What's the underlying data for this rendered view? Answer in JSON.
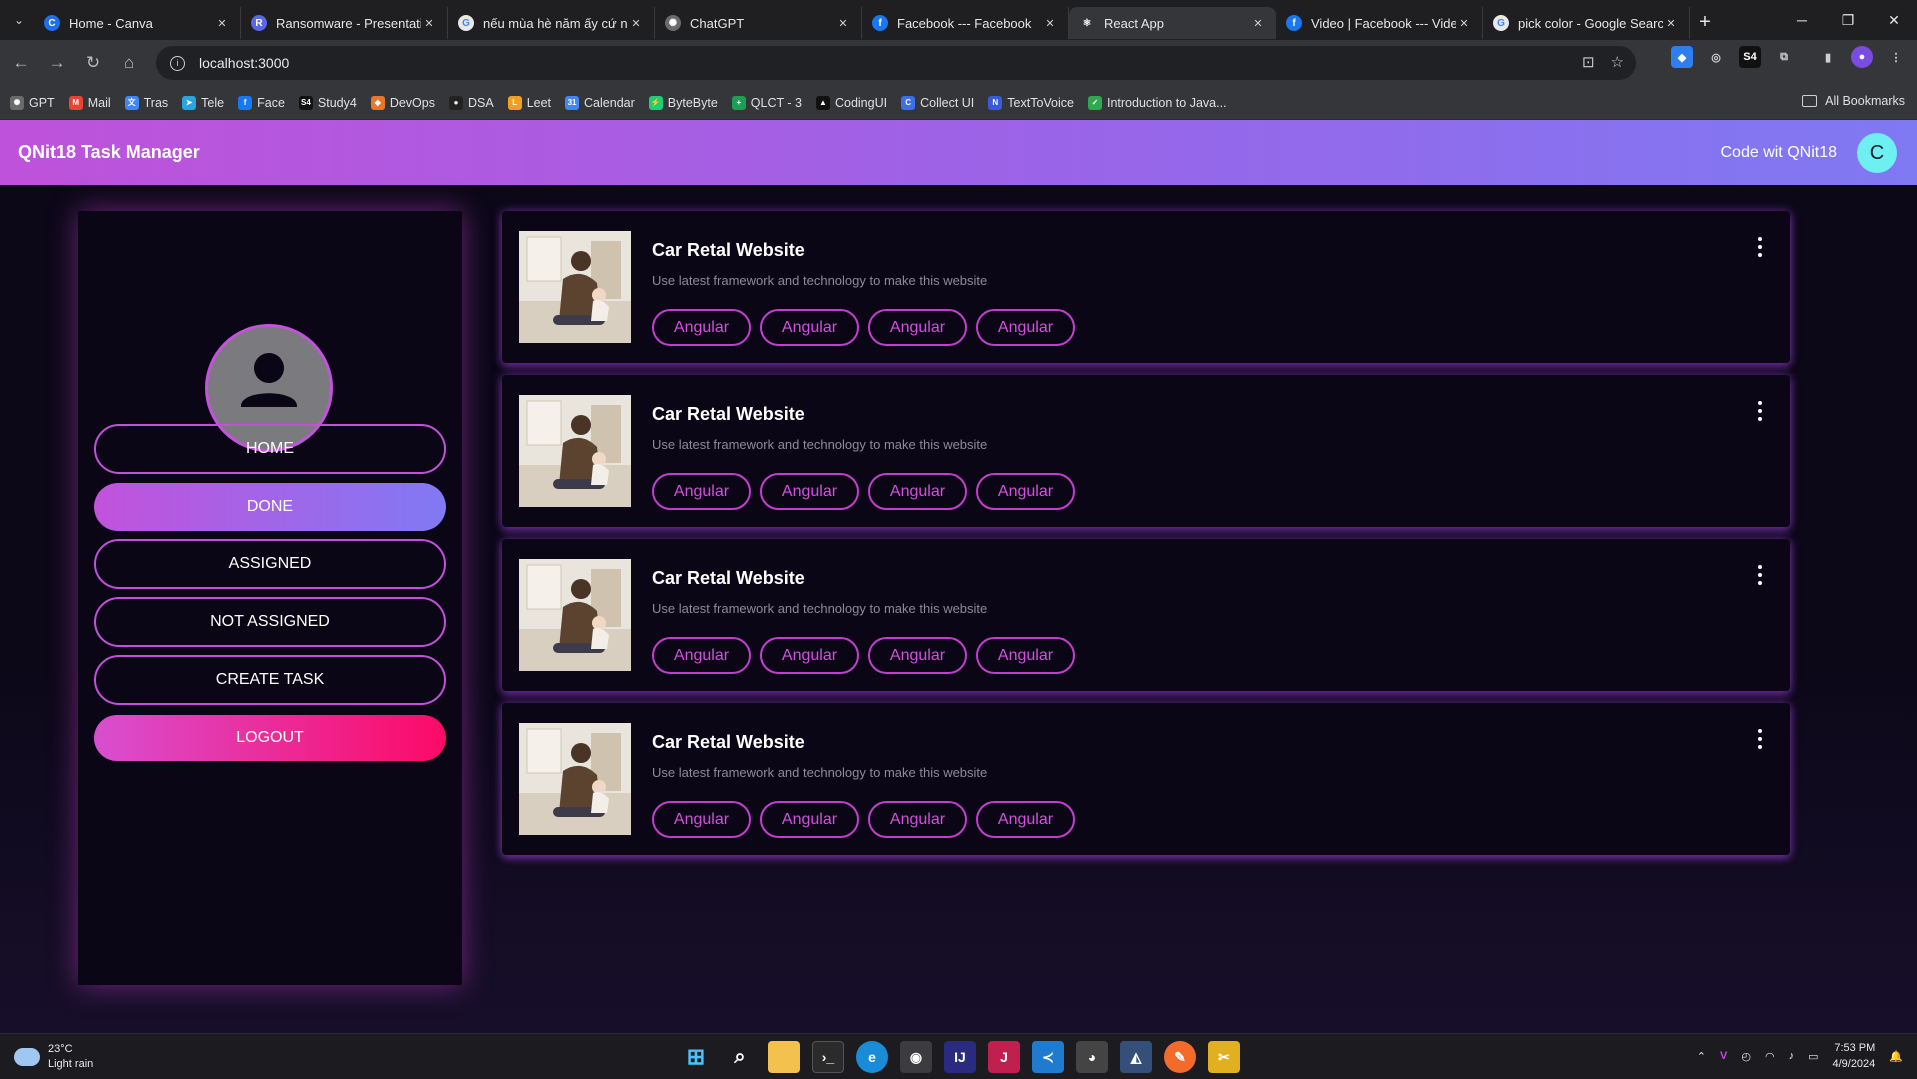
{
  "browser": {
    "tabs": [
      {
        "title": "Home - Canva",
        "icon_color": "#1f6feb",
        "glyph": "C",
        "active": false
      },
      {
        "title": "Ransomware - Presentation",
        "icon_color": "#5a67e8",
        "glyph": "R",
        "active": false
      },
      {
        "title": "nếu mùa hè năm ấy cứ ng",
        "icon_color": "#e8e8e8",
        "glyph": "G",
        "active": false
      },
      {
        "title": "ChatGPT",
        "icon_color": "#6b6b6b",
        "glyph": "✺",
        "active": false
      },
      {
        "title": "Facebook --- Facebook",
        "icon_color": "#1877f2",
        "glyph": "f",
        "active": false
      },
      {
        "title": "React App",
        "icon_color": "#35363a",
        "glyph": "⚛",
        "active": true
      },
      {
        "title": "Video | Facebook --- Video",
        "icon_color": "#1877f2",
        "glyph": "f",
        "active": false
      },
      {
        "title": "pick color - Google Search",
        "icon_color": "#e8e8e8",
        "glyph": "G",
        "active": false
      }
    ],
    "url": "localhost:3000",
    "bookmarks": [
      {
        "label": "GPT",
        "color": "#6b6b6b",
        "glyph": "✺"
      },
      {
        "label": "Mail",
        "color": "#ea4335",
        "glyph": "M"
      },
      {
        "label": "Tras",
        "color": "#4285f4",
        "glyph": "文"
      },
      {
        "label": "Tele",
        "color": "#2aa3df",
        "glyph": "➤"
      },
      {
        "label": "Face",
        "color": "#1877f2",
        "glyph": "f"
      },
      {
        "label": "Study4",
        "color": "#111111",
        "glyph": "S4"
      },
      {
        "label": "DevOps",
        "color": "#e8772e",
        "glyph": "◆"
      },
      {
        "label": "DSA",
        "color": "#222222",
        "glyph": "●"
      },
      {
        "label": "Leet",
        "color": "#f0a020",
        "glyph": "L"
      },
      {
        "label": "Calendar",
        "color": "#4285f4",
        "glyph": "31"
      },
      {
        "label": "ByteByte",
        "color": "#2c7",
        "glyph": "⚡"
      },
      {
        "label": "QLCT - 3",
        "color": "#1e9e55",
        "glyph": "+"
      },
      {
        "label": "CodingUI",
        "color": "#111111",
        "glyph": "▲"
      },
      {
        "label": "Collect UI",
        "color": "#3a6ff0",
        "glyph": "C"
      },
      {
        "label": "TextToVoice",
        "color": "#3a5bd9",
        "glyph": "N"
      },
      {
        "label": "Introduction to Java...",
        "color": "#2fa84f",
        "glyph": "✓"
      }
    ],
    "all_bookmarks_label": "All Bookmarks"
  },
  "app": {
    "title": "QNit18 Task Manager",
    "user_name": "Code wit QNit18",
    "avatar_letter": "C",
    "nav": {
      "home": "HOME",
      "done": "DONE",
      "assigned": "ASSIGNED",
      "not_assigned": "NOT ASSIGNED",
      "create_task": "CREATE TASK",
      "logout": "LOGOUT"
    },
    "tasks": [
      {
        "title": "Car Retal Website",
        "description": "Use latest framework and technology to make this website",
        "tags": [
          "Angular",
          "Angular",
          "Angular",
          "Angular"
        ]
      },
      {
        "title": "Car Retal Website",
        "description": "Use latest framework and technology to make this website",
        "tags": [
          "Angular",
          "Angular",
          "Angular",
          "Angular"
        ]
      },
      {
        "title": "Car Retal Website",
        "description": "Use latest framework and technology to make this website",
        "tags": [
          "Angular",
          "Angular",
          "Angular",
          "Angular"
        ]
      },
      {
        "title": "Car Retal Website",
        "description": "Use latest framework and technology to make this website",
        "tags": [
          "Angular",
          "Angular",
          "Angular",
          "Angular"
        ]
      }
    ],
    "colors": {
      "header_gradient_start": "#bf52da",
      "header_gradient_end": "#7f79f2",
      "accent_border": "#c34fda",
      "logout_gradient_end": "#fc0a66",
      "avatar_bg": "#6ef0f3"
    }
  },
  "taskbar": {
    "temperature": "23°C",
    "weather": "Light rain",
    "time": "7:53 PM",
    "date": "4/9/2024"
  }
}
